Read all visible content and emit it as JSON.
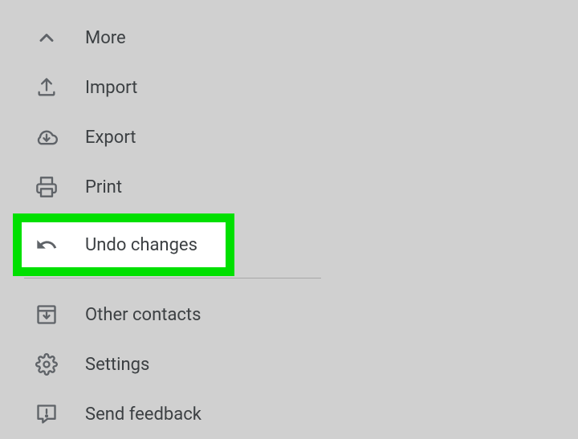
{
  "menu": {
    "more": {
      "label": "More"
    },
    "import": {
      "label": "Import"
    },
    "export": {
      "label": "Export"
    },
    "print": {
      "label": "Print"
    },
    "undo_changes": {
      "label": "Undo changes"
    },
    "other_contacts": {
      "label": "Other contacts"
    },
    "settings": {
      "label": "Settings"
    },
    "send_feedback": {
      "label": "Send feedback"
    }
  },
  "colors": {
    "highlight": "#00e000",
    "icon": "#5f6368",
    "text": "#3c4043"
  }
}
